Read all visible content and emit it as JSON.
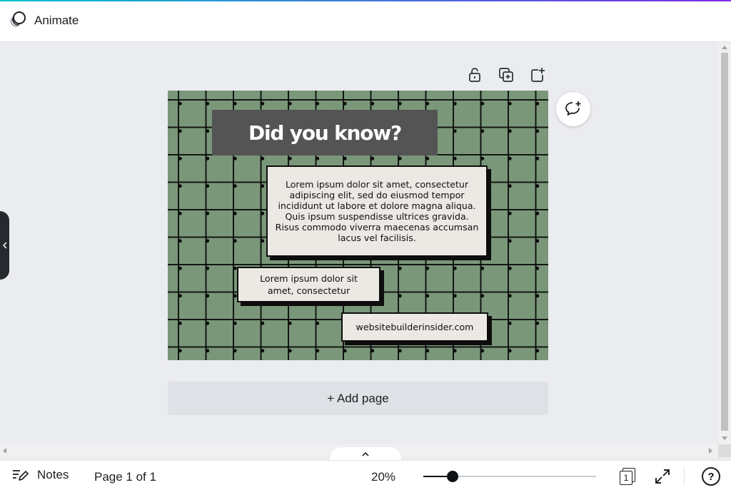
{
  "topbar": {
    "animate_label": "Animate"
  },
  "design": {
    "headline": "Did you know?",
    "body_text": "Lorem ipsum dolor sit amet, consectetur adipiscing elit, sed do eiusmod tempor incididunt ut labore et dolore magna aliqua. Quis ipsum suspendisse ultrices gravida. Risus commodo viverra maecenas accumsan lacus vel facilisis.",
    "small_text": "Lorem ipsum dolor sit amet, consectetur",
    "url_text": "websitebuilderinsider.com",
    "colors": {
      "background": "#7a977a",
      "headline_box": "#545454",
      "card": "#ece8e3"
    }
  },
  "page_tools": {
    "icons": [
      "unlock-icon",
      "duplicate-page-icon",
      "add-page-icon"
    ]
  },
  "add_page": {
    "label": "+ Add page"
  },
  "bottombar": {
    "notes_label": "Notes",
    "page_info": "Page 1 of 1",
    "zoom": "20%",
    "zoom_level_fraction": 0.17,
    "page_count_badge": "1",
    "help": "?"
  }
}
